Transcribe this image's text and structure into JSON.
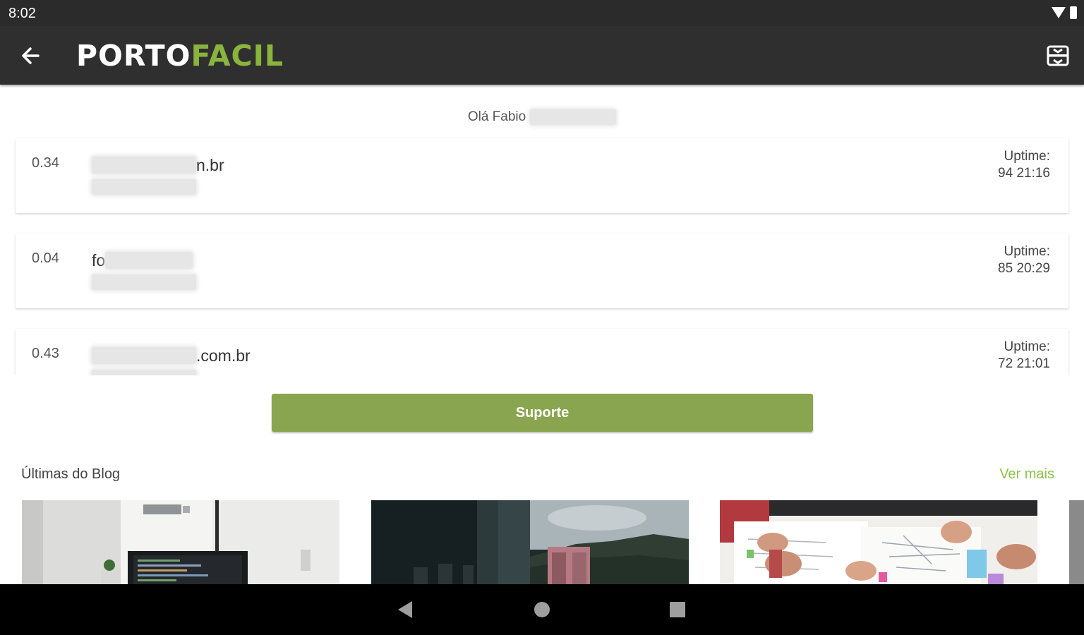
{
  "status_bar": {
    "time": "8:02",
    "icons": [
      "wifi-icon",
      "battery-icon"
    ]
  },
  "app_bar": {
    "logo_part1": "PORTO",
    "logo_part2": "FACIL",
    "back_icon": "arrow-left-icon",
    "menu_icon": "drawer-icon"
  },
  "greeting": {
    "text": "Olá Fabio"
  },
  "servers": [
    {
      "load": "0.34",
      "name_suffix": "n.br",
      "uptime_label": "Uptime:",
      "uptime_value": "94 21:16"
    },
    {
      "load": "0.04",
      "name_prefix": "fo",
      "uptime_label": "Uptime:",
      "uptime_value": "85 20:29"
    },
    {
      "load": "0.43",
      "name_suffix": ".com.br",
      "uptime_label": "Uptime:",
      "uptime_value": "72 21:01"
    }
  ],
  "support_button": {
    "label": "Suporte"
  },
  "blog": {
    "title": "Últimas do Blog",
    "more_label": "Ver mais"
  },
  "nav_bar": {
    "icons": [
      "nav-back-icon",
      "nav-home-icon",
      "nav-recents-icon"
    ]
  },
  "colors": {
    "accent_green": "#8aa54f",
    "logo_green": "#8bb43d",
    "link_green": "#8bc34a",
    "app_bar": "#2f2f2f"
  }
}
